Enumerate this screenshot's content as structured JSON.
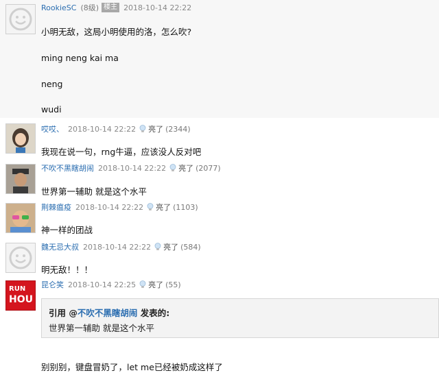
{
  "posts": [
    {
      "user": "RookieSC",
      "level": "(8级)",
      "badge": "楼主",
      "time": "2018-10-14 22:22",
      "lines": [
        "小明无敌，这局小明使用的洛，怎么吹?",
        "ming neng kai ma",
        "neng",
        "wudi"
      ]
    },
    {
      "user": "哎哎、",
      "time": "2018-10-14 22:22",
      "light_label": "亮了",
      "light_count": "(2344)",
      "text": "我现在说一句，rng牛逼，应该没人反对吧"
    },
    {
      "user": "不吹不黑瞎胡闹",
      "time": "2018-10-14 22:22",
      "light_label": "亮了",
      "light_count": "(2077)",
      "text": "世界第一辅助 就是这个水平"
    },
    {
      "user": "荆棘瘟疫",
      "time": "2018-10-14 22:22",
      "light_label": "亮了",
      "light_count": "(1103)",
      "text": "神一样的团战"
    },
    {
      "user": "魏无忌大叔",
      "time": "2018-10-14 22:22",
      "light_label": "亮了",
      "light_count": "(584)",
      "text": "明无敌！！！"
    },
    {
      "user": "昆仑笑",
      "time": "2018-10-14 22:25",
      "light_label": "亮了",
      "light_count": "(55)",
      "avatar_text_top": "RUN",
      "avatar_text_bottom": "HOU",
      "quote_prefix": "引用 @",
      "quote_user": "不吹不黑瞎胡闹",
      "quote_suffix": " 发表的:",
      "quote_text": "世界第一辅助 就是这个水平",
      "text": "别别别，键盘冒奶了，let me已经被奶成这样了"
    }
  ]
}
